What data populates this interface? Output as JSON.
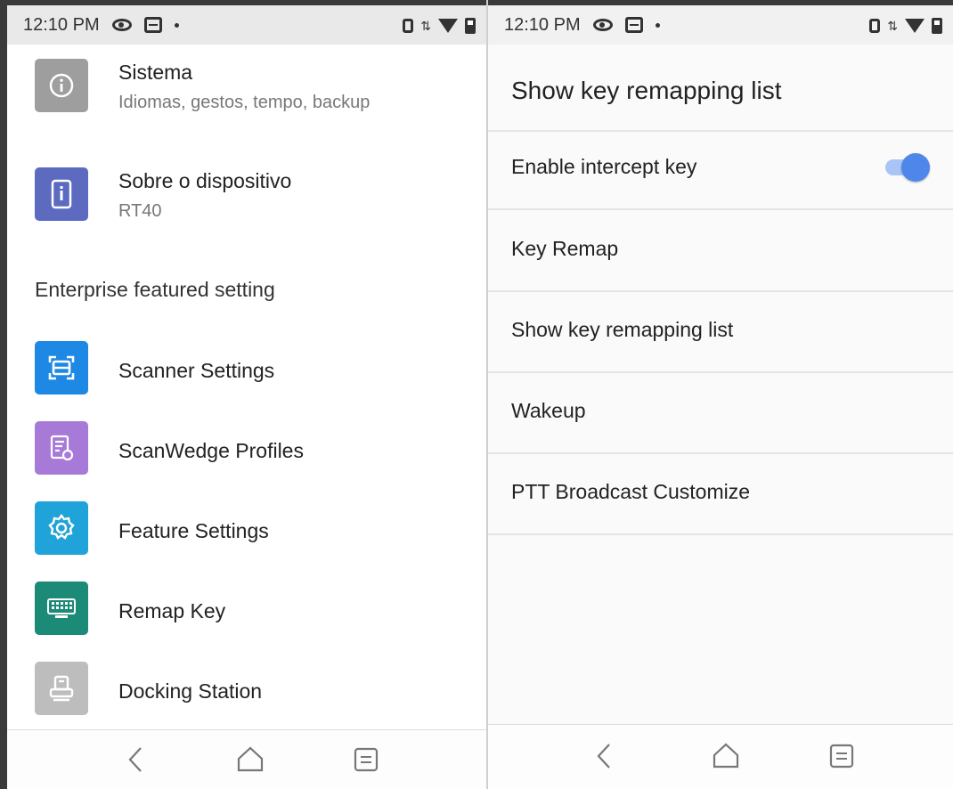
{
  "left": {
    "status": {
      "time": "12:10 PM"
    },
    "items": [
      {
        "title": "Sistema",
        "subtitle": "Idiomas, gestos, tempo, backup",
        "icon": "info-icon",
        "color": "#9e9e9e"
      },
      {
        "title": "Sobre o dispositivo",
        "subtitle": "RT40",
        "icon": "device-icon",
        "color": "#5c6bc0"
      }
    ],
    "section_header": "Enterprise featured setting",
    "enterprise_items": [
      {
        "title": "Scanner Settings",
        "icon": "scanner-icon",
        "color": "#1e88e5"
      },
      {
        "title": "ScanWedge Profiles",
        "icon": "profiles-icon",
        "color": "#a87ad8"
      },
      {
        "title": "Feature Settings",
        "icon": "gear-icon",
        "color": "#20a3d8"
      },
      {
        "title": "Remap Key",
        "icon": "keyboard-icon",
        "color": "#1b8a76"
      },
      {
        "title": "Docking Station",
        "icon": "dock-icon",
        "color": "#bdbdbd"
      }
    ]
  },
  "right": {
    "status": {
      "time": "12:10 PM"
    },
    "title": "Show key remapping list",
    "rows": [
      {
        "label": "Enable intercept key",
        "toggle": true
      },
      {
        "label": "Key Remap"
      },
      {
        "label": "Show key remapping list"
      },
      {
        "label": "Wakeup"
      },
      {
        "label": "PTT Broadcast Customize"
      }
    ],
    "accent": "#4f86ea"
  }
}
